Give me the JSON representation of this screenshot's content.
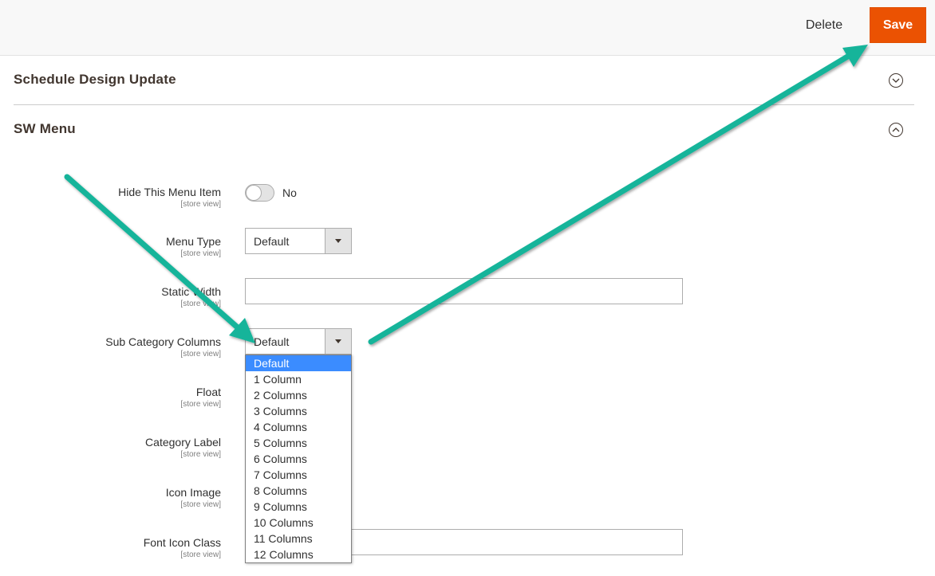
{
  "toolbar": {
    "delete_label": "Delete",
    "save_label": "Save"
  },
  "sections": {
    "schedule": {
      "title": "Schedule Design Update",
      "icon": "chevron-down-circle-icon"
    },
    "swmenu": {
      "title": "SW Menu",
      "icon": "chevron-up-circle-icon"
    }
  },
  "fields": {
    "hide": {
      "label": "Hide This Menu Item",
      "scope": "[store view]",
      "value": "No"
    },
    "menu_type": {
      "label": "Menu Type",
      "scope": "[store view]",
      "value": "Default"
    },
    "static_width": {
      "label": "Static Width",
      "scope": "[store view]",
      "value": ""
    },
    "sub_cat_cols": {
      "label": "Sub Category Columns",
      "scope": "[store view]",
      "value": "Default"
    },
    "float": {
      "label": "Float",
      "scope": "[store view]"
    },
    "cat_label": {
      "label": "Category Label",
      "scope": "[store view]"
    },
    "icon_image": {
      "label": "Icon Image",
      "scope": "[store view]"
    },
    "font_icon": {
      "label": "Font Icon Class",
      "scope": "[store view]",
      "value": ""
    }
  },
  "dropdown_options": [
    "Default",
    "1 Column",
    "2 Columns",
    "3 Columns",
    "4 Columns",
    "5 Columns",
    "6 Columns",
    "7 Columns",
    "8 Columns",
    "9 Columns",
    "10 Columns",
    "11 Columns",
    "12 Columns"
  ],
  "dropdown_selected_index": 0,
  "colors": {
    "accent": "#eb5202",
    "annotation_arrow": "#12b49a",
    "option_highlight": "#3b8cff"
  }
}
